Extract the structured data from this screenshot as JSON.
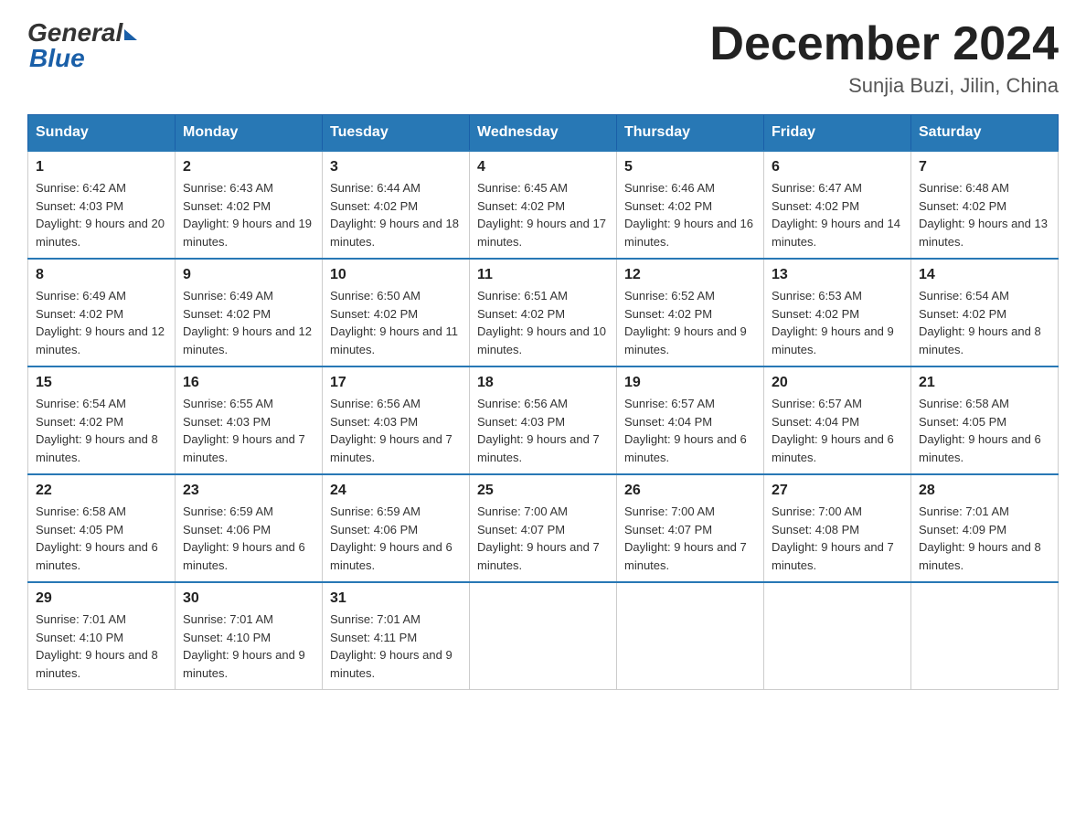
{
  "header": {
    "logo": {
      "general": "General",
      "blue": "Blue"
    },
    "title": "December 2024",
    "location": "Sunjia Buzi, Jilin, China"
  },
  "weekdays": [
    "Sunday",
    "Monday",
    "Tuesday",
    "Wednesday",
    "Thursday",
    "Friday",
    "Saturday"
  ],
  "weeks": [
    [
      {
        "day": "1",
        "sunrise": "6:42 AM",
        "sunset": "4:03 PM",
        "daylight": "9 hours and 20 minutes."
      },
      {
        "day": "2",
        "sunrise": "6:43 AM",
        "sunset": "4:02 PM",
        "daylight": "9 hours and 19 minutes."
      },
      {
        "day": "3",
        "sunrise": "6:44 AM",
        "sunset": "4:02 PM",
        "daylight": "9 hours and 18 minutes."
      },
      {
        "day": "4",
        "sunrise": "6:45 AM",
        "sunset": "4:02 PM",
        "daylight": "9 hours and 17 minutes."
      },
      {
        "day": "5",
        "sunrise": "6:46 AM",
        "sunset": "4:02 PM",
        "daylight": "9 hours and 16 minutes."
      },
      {
        "day": "6",
        "sunrise": "6:47 AM",
        "sunset": "4:02 PM",
        "daylight": "9 hours and 14 minutes."
      },
      {
        "day": "7",
        "sunrise": "6:48 AM",
        "sunset": "4:02 PM",
        "daylight": "9 hours and 13 minutes."
      }
    ],
    [
      {
        "day": "8",
        "sunrise": "6:49 AM",
        "sunset": "4:02 PM",
        "daylight": "9 hours and 12 minutes."
      },
      {
        "day": "9",
        "sunrise": "6:49 AM",
        "sunset": "4:02 PM",
        "daylight": "9 hours and 12 minutes."
      },
      {
        "day": "10",
        "sunrise": "6:50 AM",
        "sunset": "4:02 PM",
        "daylight": "9 hours and 11 minutes."
      },
      {
        "day": "11",
        "sunrise": "6:51 AM",
        "sunset": "4:02 PM",
        "daylight": "9 hours and 10 minutes."
      },
      {
        "day": "12",
        "sunrise": "6:52 AM",
        "sunset": "4:02 PM",
        "daylight": "9 hours and 9 minutes."
      },
      {
        "day": "13",
        "sunrise": "6:53 AM",
        "sunset": "4:02 PM",
        "daylight": "9 hours and 9 minutes."
      },
      {
        "day": "14",
        "sunrise": "6:54 AM",
        "sunset": "4:02 PM",
        "daylight": "9 hours and 8 minutes."
      }
    ],
    [
      {
        "day": "15",
        "sunrise": "6:54 AM",
        "sunset": "4:02 PM",
        "daylight": "9 hours and 8 minutes."
      },
      {
        "day": "16",
        "sunrise": "6:55 AM",
        "sunset": "4:03 PM",
        "daylight": "9 hours and 7 minutes."
      },
      {
        "day": "17",
        "sunrise": "6:56 AM",
        "sunset": "4:03 PM",
        "daylight": "9 hours and 7 minutes."
      },
      {
        "day": "18",
        "sunrise": "6:56 AM",
        "sunset": "4:03 PM",
        "daylight": "9 hours and 7 minutes."
      },
      {
        "day": "19",
        "sunrise": "6:57 AM",
        "sunset": "4:04 PM",
        "daylight": "9 hours and 6 minutes."
      },
      {
        "day": "20",
        "sunrise": "6:57 AM",
        "sunset": "4:04 PM",
        "daylight": "9 hours and 6 minutes."
      },
      {
        "day": "21",
        "sunrise": "6:58 AM",
        "sunset": "4:05 PM",
        "daylight": "9 hours and 6 minutes."
      }
    ],
    [
      {
        "day": "22",
        "sunrise": "6:58 AM",
        "sunset": "4:05 PM",
        "daylight": "9 hours and 6 minutes."
      },
      {
        "day": "23",
        "sunrise": "6:59 AM",
        "sunset": "4:06 PM",
        "daylight": "9 hours and 6 minutes."
      },
      {
        "day": "24",
        "sunrise": "6:59 AM",
        "sunset": "4:06 PM",
        "daylight": "9 hours and 6 minutes."
      },
      {
        "day": "25",
        "sunrise": "7:00 AM",
        "sunset": "4:07 PM",
        "daylight": "9 hours and 7 minutes."
      },
      {
        "day": "26",
        "sunrise": "7:00 AM",
        "sunset": "4:07 PM",
        "daylight": "9 hours and 7 minutes."
      },
      {
        "day": "27",
        "sunrise": "7:00 AM",
        "sunset": "4:08 PM",
        "daylight": "9 hours and 7 minutes."
      },
      {
        "day": "28",
        "sunrise": "7:01 AM",
        "sunset": "4:09 PM",
        "daylight": "9 hours and 8 minutes."
      }
    ],
    [
      {
        "day": "29",
        "sunrise": "7:01 AM",
        "sunset": "4:10 PM",
        "daylight": "9 hours and 8 minutes."
      },
      {
        "day": "30",
        "sunrise": "7:01 AM",
        "sunset": "4:10 PM",
        "daylight": "9 hours and 9 minutes."
      },
      {
        "day": "31",
        "sunrise": "7:01 AM",
        "sunset": "4:11 PM",
        "daylight": "9 hours and 9 minutes."
      },
      null,
      null,
      null,
      null
    ]
  ]
}
